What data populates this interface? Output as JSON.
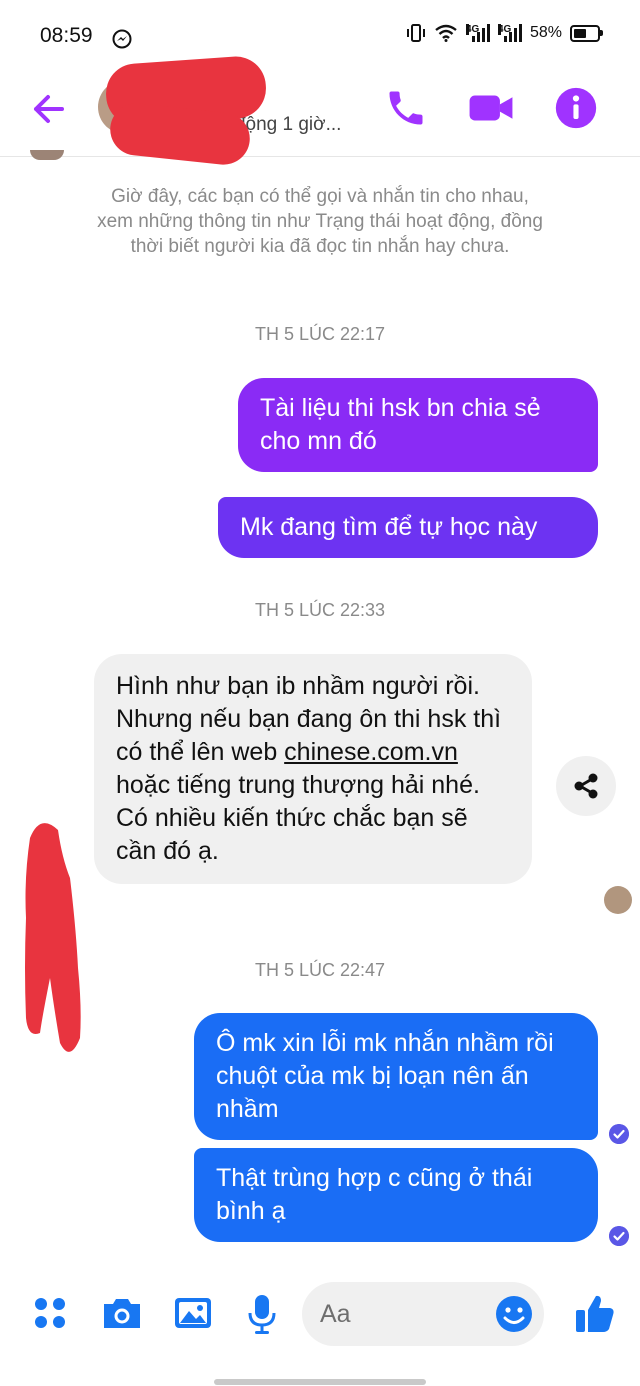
{
  "status_bar": {
    "time": "08:59",
    "network_labels": [
      "4G",
      "4G"
    ],
    "battery": "58%"
  },
  "header": {
    "contact_status": "...at động 1 giờ..."
  },
  "conversation": {
    "system_note": "Giờ đây, các bạn có thể gọi và nhắn tin cho nhau, xem những thông tin như Trạng thái hoạt động, đồng thời biết người kia đã đọc tin nhắn hay chưa.",
    "timestamps": [
      "TH 5 LÚC 22:17",
      "TH 5 LÚC 22:33",
      "TH 5 LÚC 22:47"
    ],
    "messages": [
      {
        "from": "me",
        "text": "Tài liệu thi hsk bn chia sẻ cho mn đó"
      },
      {
        "from": "me",
        "text": "Mk đang tìm để tự học này"
      },
      {
        "from": "them",
        "text_before": "Hình như bạn ib nhầm người rồi. Nhưng nếu bạn đang ôn thi hsk thì có thể lên web ",
        "link": "chinese.com.vn",
        "text_after": " hoặc tiếng trung thượng hải nhé. Có nhiều kiến thức chắc bạn sẽ cần đó ạ."
      },
      {
        "from": "me",
        "text": "Ô mk xin lỗi mk nhắn nhầm rồi chuột của mk bị loạn nên ấn nhầm"
      },
      {
        "from": "me",
        "text": "Thật trùng hợp c cũng ở thái bình ạ"
      }
    ]
  },
  "composer": {
    "placeholder": "Aa"
  },
  "colors": {
    "accent": "#a033ff",
    "bubble_purple": "#8a2bf5",
    "bubble_purple_2": "#6d33f2",
    "bubble_blue": "#1a6df5",
    "composer_icons": "#1877f2",
    "redaction": "#e8343f"
  },
  "icons": [
    "back-arrow-icon",
    "phone-icon",
    "video-camera-icon",
    "info-icon",
    "share-icon",
    "apps-icon",
    "camera-icon",
    "image-icon",
    "microphone-icon",
    "emoji-icon",
    "thumbs-up-icon",
    "seen-check-icon",
    "messenger-icon",
    "wifi-icon",
    "signal-icon",
    "battery-icon",
    "vibrate-icon"
  ]
}
